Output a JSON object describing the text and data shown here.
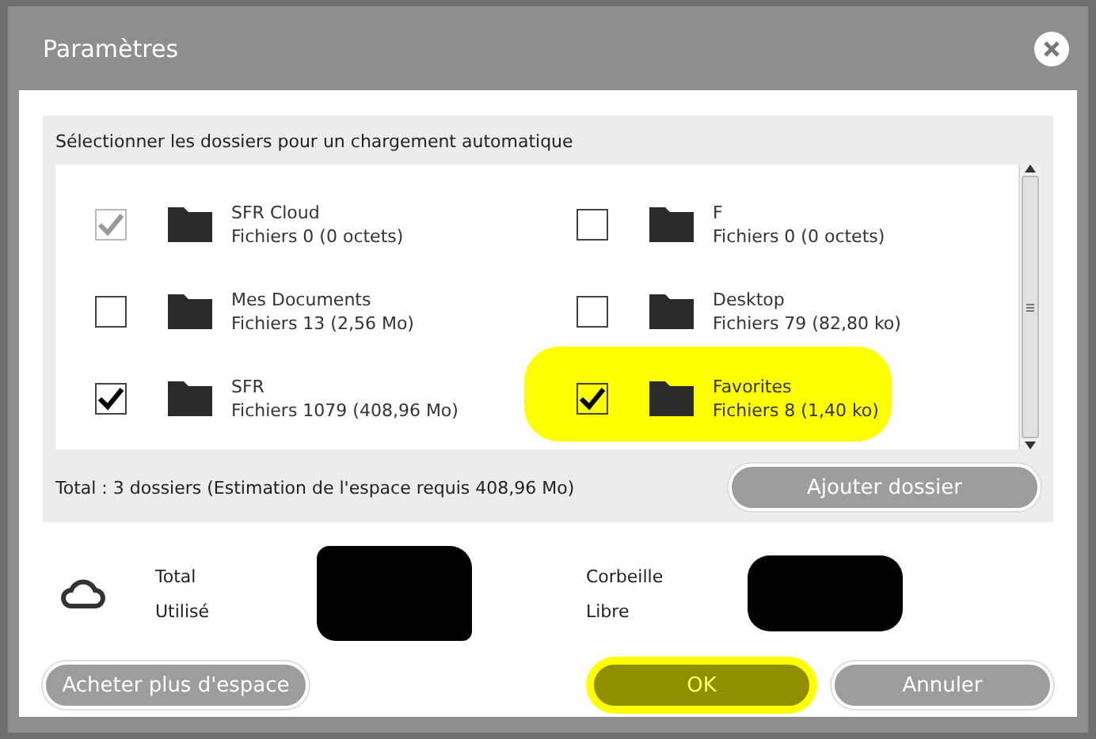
{
  "window": {
    "title": "Paramètres"
  },
  "folders_panel": {
    "heading": "Sélectionner les dossiers pour un chargement automatique",
    "folders": [
      {
        "name": "SFR Cloud",
        "files": "Fichiers 0 (0 octets)",
        "checked": true,
        "disabled": true,
        "highlighted": false
      },
      {
        "name": "F",
        "files": "Fichiers 0 (0 octets)",
        "checked": false,
        "disabled": false,
        "highlighted": false
      },
      {
        "name": "Mes Documents",
        "files": "Fichiers 13 (2,56 Mo)",
        "checked": false,
        "disabled": false,
        "highlighted": false
      },
      {
        "name": "Desktop",
        "files": "Fichiers 79 (82,80 ko)",
        "checked": false,
        "disabled": false,
        "highlighted": false
      },
      {
        "name": "SFR",
        "files": "Fichiers 1079 (408,96 Mo)",
        "checked": true,
        "disabled": false,
        "highlighted": false
      },
      {
        "name": "Favorites",
        "files": "Fichiers 8 (1,40 ko)",
        "checked": true,
        "disabled": false,
        "highlighted": true
      }
    ],
    "total": "Total : 3 dossiers (Estimation de l'espace requis 408,96 Mo)",
    "add_button": "Ajouter dossier"
  },
  "storage": {
    "left_labels": [
      "Total",
      "Utilisé"
    ],
    "right_labels": [
      "Corbeille",
      "Libre"
    ]
  },
  "buttons": [
    {
      "label": "Acheter plus d'espace",
      "highlighted": false
    },
    {
      "label": "OK",
      "highlighted": true
    },
    {
      "label": "Annuler",
      "highlighted": false
    }
  ]
}
